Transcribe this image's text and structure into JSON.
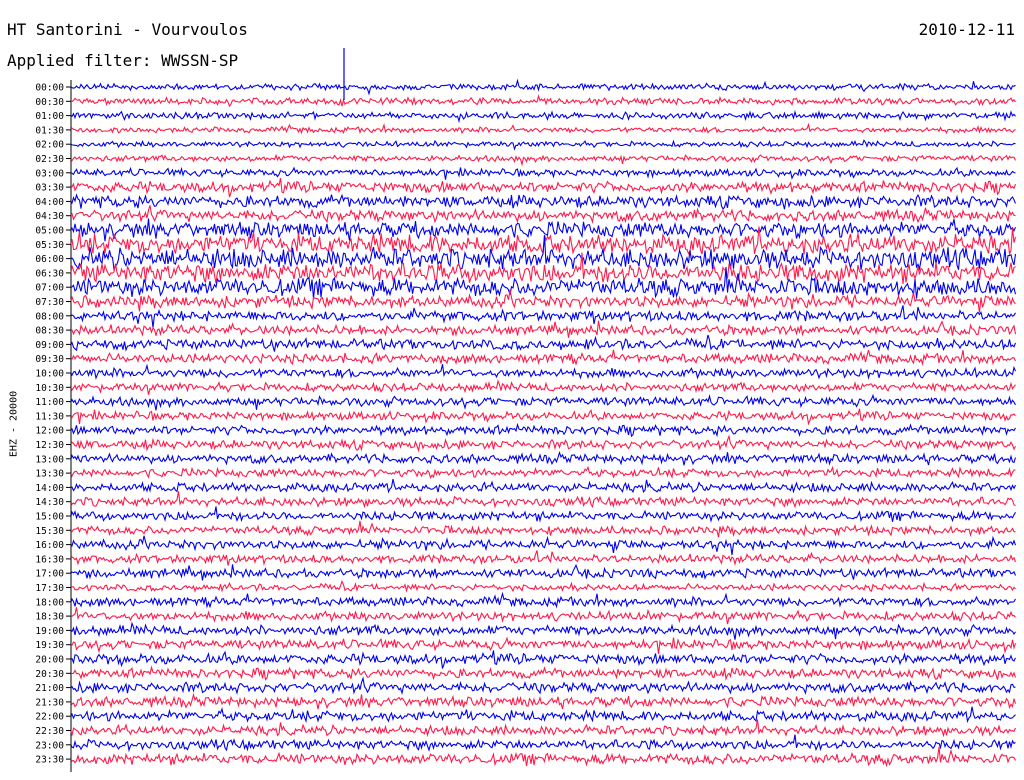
{
  "header": {
    "station": "HT Santorini - Vourvoulos",
    "date": "2010-12-11",
    "filter": "Applied filter: WWSSN-SP"
  },
  "chart_data": {
    "type": "helicorder",
    "ylabel": "EHZ - 20000",
    "row_labels": [
      "00:00",
      "00:30",
      "01:00",
      "01:30",
      "02:00",
      "02:30",
      "03:00",
      "03:30",
      "04:00",
      "04:30",
      "05:00",
      "05:30",
      "06:00",
      "06:30",
      "07:00",
      "07:30",
      "08:00",
      "08:30",
      "09:00",
      "09:30",
      "10:00",
      "10:30",
      "11:00",
      "11:30",
      "12:00",
      "12:30",
      "13:00",
      "13:30",
      "14:00",
      "14:30",
      "15:00",
      "15:30",
      "16:00",
      "16:30",
      "17:00",
      "17:30",
      "18:00",
      "18:30",
      "19:00",
      "19:30",
      "20:00",
      "20:30",
      "21:00",
      "21:30",
      "22:00",
      "22:30",
      "23:00",
      "23:30"
    ],
    "trace_colors": [
      "#0000ee",
      "#ff1a4a"
    ],
    "relative_amplitude": [
      0.5,
      0.55,
      0.55,
      0.45,
      0.45,
      0.5,
      0.6,
      0.9,
      1.0,
      0.95,
      1.3,
      1.6,
      1.7,
      1.6,
      1.5,
      1.0,
      0.85,
      0.8,
      0.85,
      0.8,
      0.75,
      0.7,
      0.75,
      0.7,
      0.75,
      0.75,
      0.75,
      0.7,
      0.75,
      0.75,
      0.75,
      0.7,
      0.75,
      0.7,
      0.75,
      0.55,
      0.75,
      0.75,
      0.8,
      0.8,
      0.85,
      0.8,
      0.85,
      0.85,
      0.85,
      0.8,
      0.8,
      0.9
    ]
  }
}
